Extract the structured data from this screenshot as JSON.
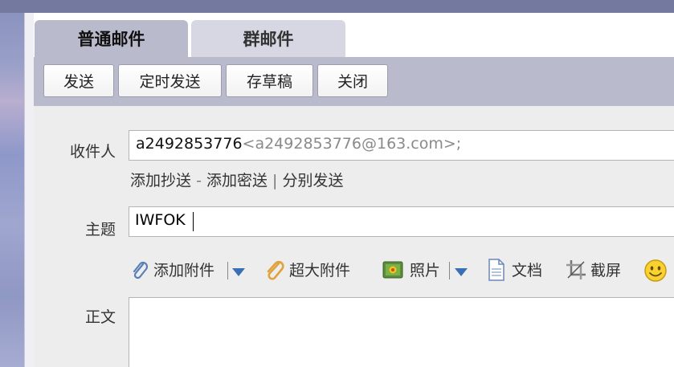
{
  "tabs": [
    {
      "label": "普通邮件",
      "active": true
    },
    {
      "label": "群邮件",
      "active": false
    }
  ],
  "toolbar": {
    "send": "发送",
    "scheduled_send": "定时发送",
    "save_draft": "存草稿",
    "close": "关闭"
  },
  "form": {
    "to_label": "收件人",
    "to_name": "a2492853776",
    "to_address": "<a2492853776@163.com>;",
    "add_cc": "添加抄送",
    "dash": "-",
    "add_bcc": "添加密送",
    "pipe": "|",
    "separate_send": "分别发送",
    "subject_label": "主题",
    "subject_value": "IWFOK",
    "body_label": "正文"
  },
  "attachments": {
    "add_attachment": "添加附件",
    "large_attachment": "超大附件",
    "photo": "照片",
    "document": "文档",
    "screenshot": "截屏"
  },
  "icons": [
    "paperclip-icon",
    "large-paperclip-icon",
    "photo-icon",
    "document-icon",
    "screenshot-icon",
    "emoji-icon"
  ],
  "colors": {
    "tab_active": "#b9bbcc",
    "tab_inactive": "#d6d7e2",
    "accent_arrow": "#3b6fb5"
  }
}
